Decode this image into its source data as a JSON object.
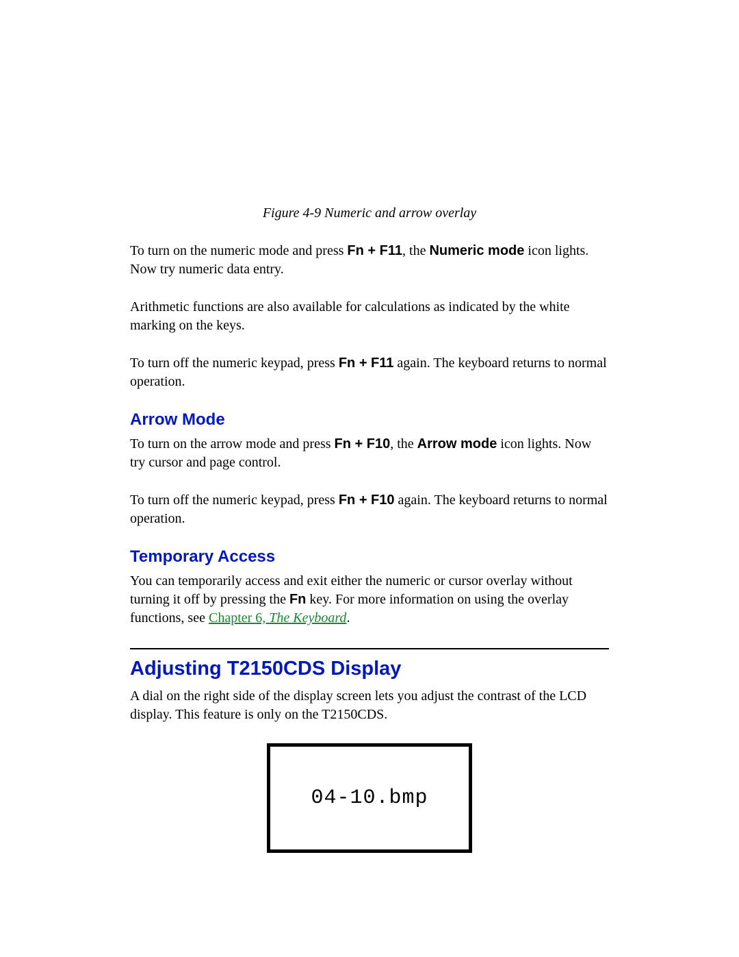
{
  "figcaption": "Figure 4-9 Numeric and arrow overlay",
  "p1": {
    "a": "To turn on the numeric mode and press ",
    "key": "Fn + F11",
    "b": ", the ",
    "mode": "Numeric mode",
    "c": " icon lights. Now try numeric data entry."
  },
  "p2": "Arithmetic functions are also available for calculations as indicated by the white marking on the keys.",
  "p3": {
    "a": "To turn off the numeric keypad, press ",
    "key": "Fn + F11",
    "b": " again. The keyboard returns to normal operation."
  },
  "h_arrow": "Arrow Mode",
  "p4": {
    "a": "To turn on the arrow mode and press ",
    "key": "Fn + F10",
    "b": ", the ",
    "mode": "Arrow mode",
    "c": " icon lights. Now try cursor and page control."
  },
  "p5": {
    "a": "To turn off the numeric keypad, press ",
    "key": "Fn + F10",
    "b": " again. The keyboard returns to normal operation."
  },
  "h_temp": "Temporary Access",
  "p6": {
    "a": "You can temporarily access and exit either the numeric or cursor overlay without turning it off by pressing the ",
    "key": "Fn",
    "b": " key. For more information on using the overlay functions, see ",
    "link1": "Chapter 6, ",
    "link2": "The Keyboard",
    "c": "."
  },
  "h_adjust": "Adjusting T2150CDS Display",
  "p7": "A dial on the right side of the display screen lets you adjust the contrast of the LCD display. This feature is only on the T2150CDS.",
  "bmp": "04-10.bmp"
}
